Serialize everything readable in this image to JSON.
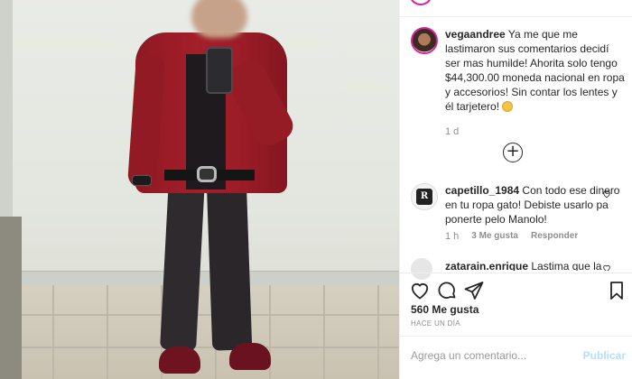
{
  "post": {
    "owner_comment": {
      "username": "vegaandree",
      "text": "Ya me que me lastimaron sus comentarios decidí ser mas humilde! Ahorita solo tengo $44,300.00 moneda nacional en ropa y accesorios! Sin contar los lentes y él tarjetero!",
      "emoji": "pensive-face-emoji",
      "time": "1 d"
    },
    "load_more_icon": "plus-circle-icon",
    "comments": [
      {
        "username": "capetillo_1984",
        "text": "Con todo ese dinero en tu ropa gato! Debiste usarlo pa ponerte pelo Manolo!",
        "time": "1 h",
        "likes": "3 Me gusta",
        "reply": "Responder"
      },
      {
        "username": "zatarain.enrique",
        "text": "Lastima que la"
      }
    ],
    "likes_count": "560 Me gusta",
    "posted_ago": "HACE UN DÍA",
    "actions": {
      "like": "heart-icon",
      "comment": "comment-bubble-icon",
      "share": "paper-plane-icon",
      "save": "bookmark-icon"
    }
  },
  "comment_box": {
    "placeholder": "Agrega un comentario...",
    "publish_label": "Publicar"
  },
  "colors": {
    "story_ring": "#d6249f",
    "publish_disabled": "#b2dffc",
    "muted_text": "#8e8e8e"
  }
}
